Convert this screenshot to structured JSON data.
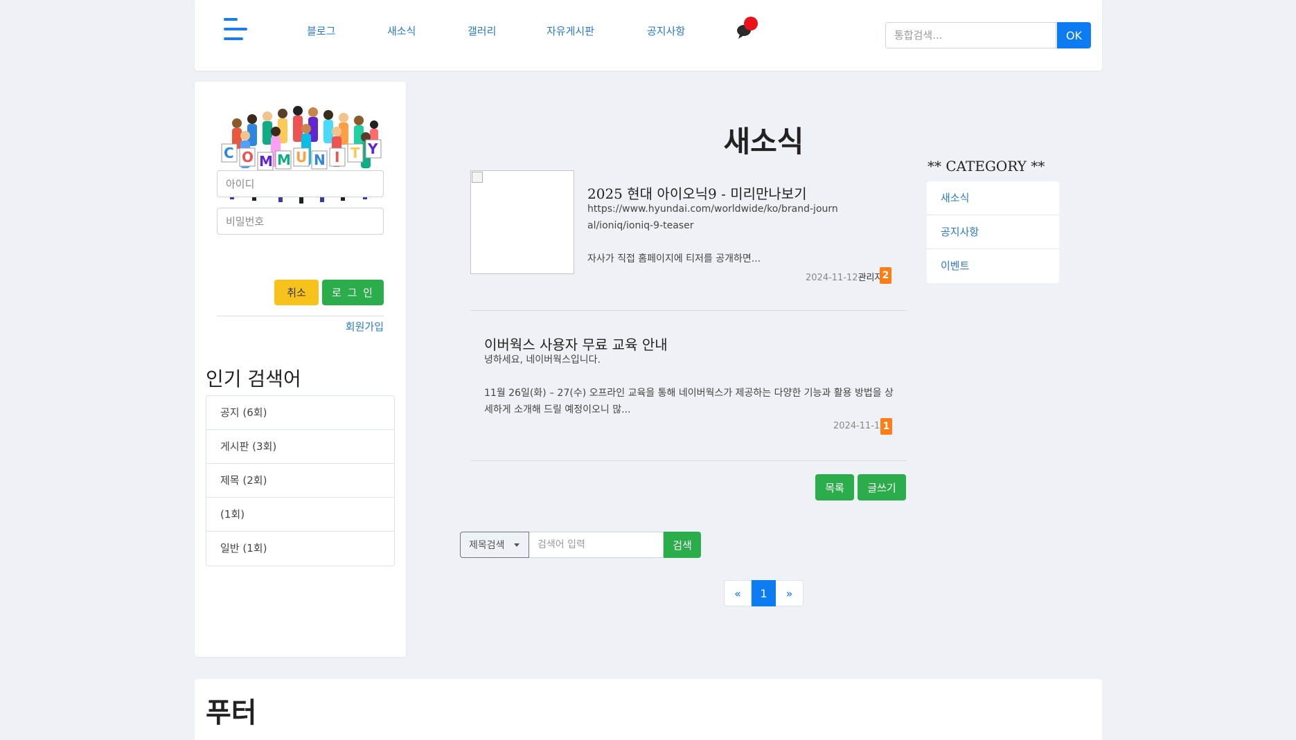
{
  "header": {
    "nav": [
      "블로그",
      "새소식",
      "갤러리",
      "자유게시판",
      "공지사항"
    ],
    "search_placeholder": "통합검색...",
    "ok_label": "OK"
  },
  "sidebar": {
    "id_placeholder": "아이디",
    "pw_placeholder": "비밀번호",
    "cancel_label": "취소",
    "login_label": "로 그 인",
    "signup_label": "회원가입",
    "popular_title": "인기 검색어",
    "popular": [
      "공지 (6회)",
      "게시판 (3회)",
      "제목 (2회)",
      "(1회)",
      "일반 (1회)"
    ]
  },
  "main": {
    "title": "새소식",
    "posts": [
      {
        "title": "2025 현대 아이오닉9 - 미리만나보기",
        "url": "https://www.hyundai.com/worldwide/ko/brand-journal/ioniq/ioniq-9-teaser",
        "excerpt": "자사가 직접 홈페이지에 티저를 공개하면...",
        "date": "2024-11-12",
        "author": "관리자",
        "comments": "2"
      },
      {
        "title": "이버웍스 사용자 무료 교육 안내",
        "greeting": "녕하세요, 네이버웍스입니다.",
        "excerpt": "11월 26일(화) – 27(수) 오프라인 교육을 통해 네이버웍스가 제공하는 다양한 기능과 활용 방법을 상세하게 소개해 드릴 예정이오니 많...",
        "date": "2024-11-12",
        "comments": "1"
      }
    ],
    "list_label": "목록",
    "write_label": "글쓰기",
    "search_select": "제목검색",
    "search_placeholder": "검색어 입력",
    "search_button": "검색",
    "pagination": {
      "prev": "«",
      "current": "1",
      "next": "»"
    }
  },
  "category": {
    "title": "** CATEGORY **",
    "items": [
      "새소식",
      "공지사항",
      "이벤트"
    ]
  },
  "footer": {
    "title": "푸터"
  },
  "colors": {
    "accent_blue": "#0d7bf2",
    "link_blue": "#2a78d0",
    "green": "#2bad4b",
    "yellow": "#f7c21c",
    "badge_orange": "#fd7e14",
    "background": "#eef1f5"
  },
  "icons": [
    "hamburger-menu-icon",
    "chat-bubble-icon",
    "community-logo",
    "broken-image-icon",
    "caret-down-icon"
  ]
}
